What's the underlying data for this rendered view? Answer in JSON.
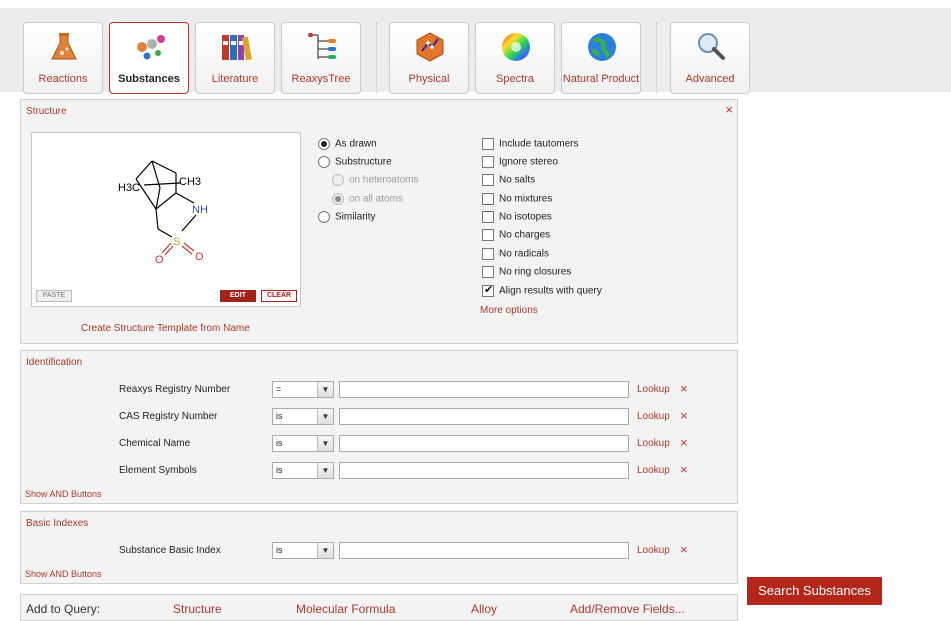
{
  "tabs": [
    {
      "label": "Reactions",
      "icon": "flask-icon"
    },
    {
      "label": "Substances",
      "icon": "molecules-icon"
    },
    {
      "label": "Literature",
      "icon": "binders-icon"
    },
    {
      "label": "ReaxysTree",
      "icon": "tree-icon"
    },
    {
      "label": "Physical",
      "icon": "physical-icon"
    },
    {
      "label": "Spectra",
      "icon": "color-wheel-icon"
    },
    {
      "label": "Natural Product",
      "icon": "globe-icon"
    },
    {
      "label": "Advanced",
      "icon": "magnifier-icon"
    }
  ],
  "active_tab": "Substances",
  "structure": {
    "title": "Structure",
    "close": "×",
    "paste": "PASTE",
    "edit": "EDIT",
    "clear": "CLEAR",
    "create_link": "Create Structure Template from Name",
    "molecule": {
      "h3c": "H3C",
      "ch3": "CH3",
      "nh": "NH",
      "s": "S",
      "o1": "O",
      "o2": "O"
    },
    "match_options": [
      {
        "label": "As drawn",
        "selected": true
      },
      {
        "label": "Substructure",
        "selected": false
      },
      {
        "label": "on heteroatoms",
        "selected": false,
        "disabled": true
      },
      {
        "label": "on all atoms",
        "selected": true,
        "disabled": true
      },
      {
        "label": "Similarity",
        "selected": false
      }
    ],
    "filters": [
      {
        "label": "Include tautomers",
        "checked": false
      },
      {
        "label": "Ignore stereo",
        "checked": false
      },
      {
        "label": "No salts",
        "checked": false
      },
      {
        "label": "No mixtures",
        "checked": false
      },
      {
        "label": "No isotopes",
        "checked": false
      },
      {
        "label": "No charges",
        "checked": false
      },
      {
        "label": "No radicals",
        "checked": false
      },
      {
        "label": "No ring closures",
        "checked": false
      },
      {
        "label": "Align results with query",
        "checked": true
      }
    ],
    "more_options": "More options"
  },
  "identification": {
    "title": "Identification",
    "fields": [
      {
        "label": "Reaxys Registry Number",
        "operator": "=",
        "value": "",
        "lookup": "Lookup"
      },
      {
        "label": "CAS Registry Number",
        "operator": "is",
        "value": "",
        "lookup": "Lookup"
      },
      {
        "label": "Chemical Name",
        "operator": "is",
        "value": "",
        "lookup": "Lookup"
      },
      {
        "label": "Element Symbols",
        "operator": "is",
        "value": "",
        "lookup": "Lookup"
      }
    ],
    "show_and": "Show AND Buttons"
  },
  "basic_indexes": {
    "title": "Basic Indexes",
    "fields": [
      {
        "label": "Substance Basic Index",
        "operator": "is",
        "value": "",
        "lookup": "Lookup"
      }
    ],
    "show_and": "Show AND Buttons"
  },
  "add_to_query": {
    "label": "Add to Query:",
    "links": [
      "Structure",
      "Molecular Formula",
      "Alloy",
      "Add/Remove Fields..."
    ]
  },
  "search_button": "Search Substances",
  "colors": {
    "accent": "#a83a2a",
    "button": "#b3261a",
    "panel": "#f3f3f3"
  },
  "remove_glyph": "×"
}
